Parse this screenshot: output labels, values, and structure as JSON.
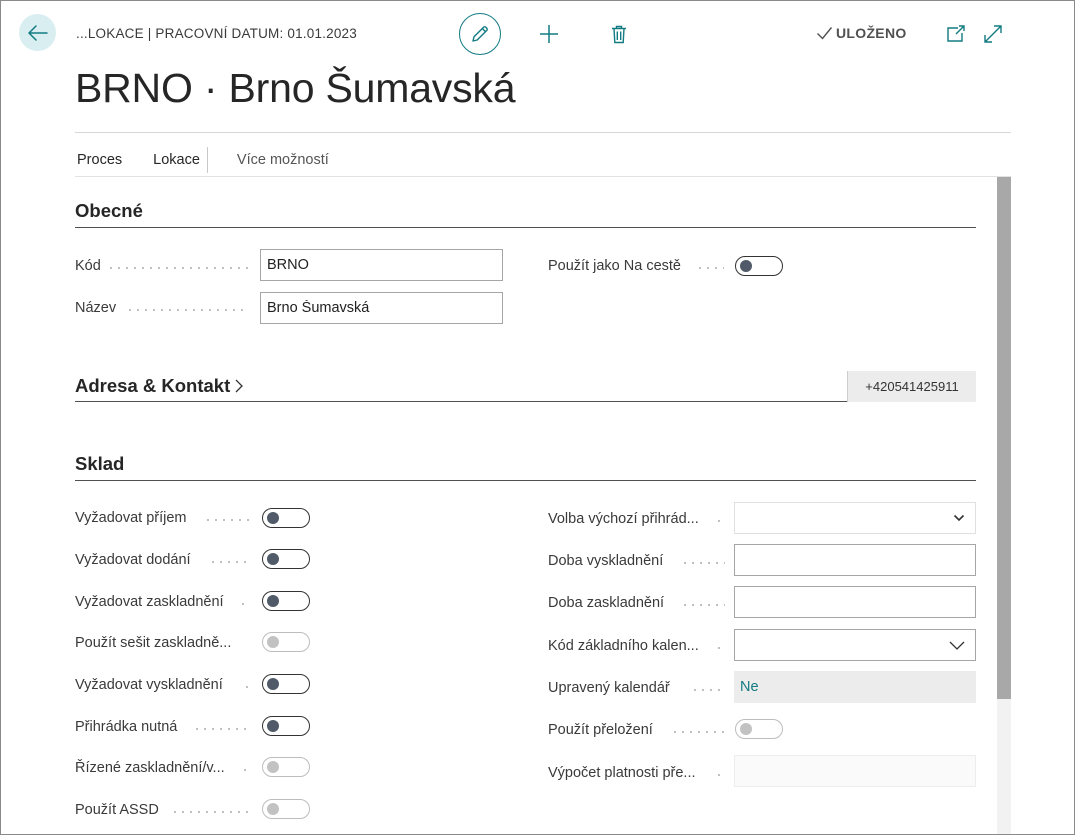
{
  "header": {
    "breadcrumb": "...LOKACE | PRACOVNÍ DATUM: 01.01.2023",
    "saved_label": "ULOŽENO",
    "title": "BRNO · Brno Šumavská"
  },
  "actionbar": {
    "items": [
      "Proces",
      "Lokace"
    ],
    "more_label": "Více možností"
  },
  "general": {
    "title": "Obecné",
    "code_label": "Kód",
    "code_value": "BRNO",
    "name_label": "Název",
    "name_value": "Brno Šumavská",
    "in_transit_label": "Použít jako Na cestě",
    "in_transit_on": false
  },
  "address": {
    "title": "Adresa & Kontakt",
    "phone": "+420541425911"
  },
  "warehouse": {
    "title": "Sklad",
    "left": [
      {
        "label": "Vyžadovat příjem",
        "on": false,
        "disabled": false
      },
      {
        "label": "Vyžadovat dodání",
        "on": false,
        "disabled": false
      },
      {
        "label": "Vyžadovat zaskladnění",
        "on": false,
        "disabled": false
      },
      {
        "label": "Použít sešit zaskladně...",
        "on": false,
        "disabled": true
      },
      {
        "label": "Vyžadovat vyskladnění",
        "on": false,
        "disabled": false
      },
      {
        "label": "Přihrádka nutná",
        "on": false,
        "disabled": false
      },
      {
        "label": "Řízené zaskladnění/v...",
        "on": false,
        "disabled": true
      },
      {
        "label": "Použít ASSD",
        "on": false,
        "disabled": true
      }
    ],
    "right": [
      {
        "label": "Volba výchozí přihrád...",
        "value": ""
      },
      {
        "label": "Doba vyskladnění",
        "value": ""
      },
      {
        "label": "Doba zaskladnění",
        "value": ""
      },
      {
        "label": "Kód základního kalen...",
        "value": ""
      },
      {
        "label": "Upravený kalendář",
        "value": "Ne"
      },
      {
        "label": "Použít přeložení",
        "on": false
      },
      {
        "label": "Výpočet platnosti pře...",
        "value": ""
      }
    ]
  },
  "colors": {
    "accent": "#127b82",
    "back_bg": "#d9eef0"
  }
}
